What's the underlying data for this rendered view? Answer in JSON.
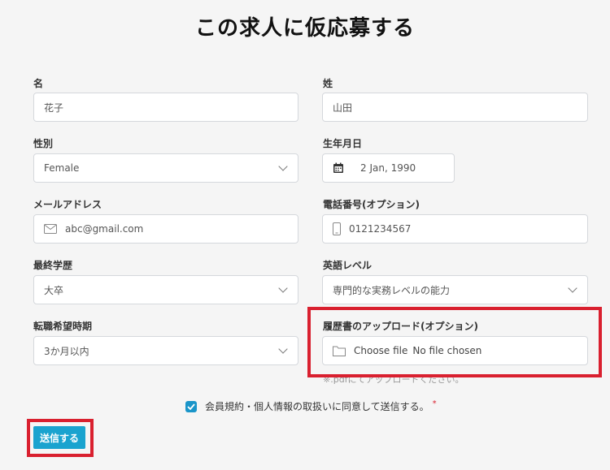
{
  "page": {
    "title": "この求人に仮応募する"
  },
  "form": {
    "first_name": {
      "label": "名",
      "value": "花子"
    },
    "last_name": {
      "label": "姓",
      "value": "山田"
    },
    "gender": {
      "label": "性別",
      "value": "Female"
    },
    "birthdate": {
      "label": "生年月日",
      "value": "2 Jan, 1990"
    },
    "email": {
      "label": "メールアドレス",
      "value": "abc@gmail.com"
    },
    "phone": {
      "label": "電話番号(オプション)",
      "value": "0121234567"
    },
    "education": {
      "label": "最終学歴",
      "value": "大卒"
    },
    "english": {
      "label": "英語レベル",
      "value": "専門的な実務レベルの能力"
    },
    "timing": {
      "label": "転職希望時期",
      "value": "3か月以内"
    },
    "resume": {
      "label": "履歴書のアップロード(オプション)",
      "button": "Choose file",
      "status": "No file chosen",
      "hint": "※.pdfにてアップロードください。"
    },
    "agreement": {
      "label": "会員規約・個人情報の取扱いに同意して送信する。",
      "required_mark": "*",
      "checked": true
    },
    "submit_label": "送信する"
  },
  "colors": {
    "accent": "#1aa3cf",
    "highlight": "#d9202f",
    "checkbox": "#1a95c9"
  },
  "icons": {
    "gender": "chevron-down-icon",
    "birthdate": "calendar-icon",
    "email": "envelope-icon",
    "phone": "mobile-phone-icon",
    "education": "chevron-down-icon",
    "english": "chevron-down-icon",
    "timing": "chevron-down-icon",
    "resume": "folder-icon",
    "agreement": "checkmark-icon"
  }
}
